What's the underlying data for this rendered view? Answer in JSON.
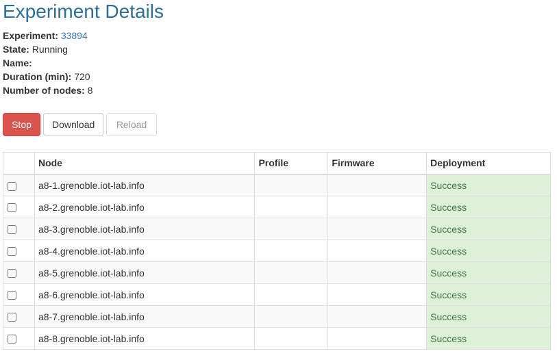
{
  "page": {
    "title": "Experiment Details"
  },
  "info": {
    "experiment_label": "Experiment:",
    "experiment_id": "33894",
    "state_label": "State:",
    "state_value": "Running",
    "name_label": "Name:",
    "name_value": "",
    "duration_label": "Duration (min):",
    "duration_value": "720",
    "nodes_label": "Number of nodes:",
    "nodes_value": "8"
  },
  "toolbar": {
    "stop_label": "Stop",
    "download_label": "Download",
    "reload_label": "Reload"
  },
  "table": {
    "headers": {
      "check": "",
      "node": "Node",
      "profile": "Profile",
      "firmware": "Firmware",
      "deployment": "Deployment"
    },
    "rows": [
      {
        "node": "a8-1.grenoble.iot-lab.info",
        "profile": "",
        "firmware": "",
        "deployment": "Success"
      },
      {
        "node": "a8-2.grenoble.iot-lab.info",
        "profile": "",
        "firmware": "",
        "deployment": "Success"
      },
      {
        "node": "a8-3.grenoble.iot-lab.info",
        "profile": "",
        "firmware": "",
        "deployment": "Success"
      },
      {
        "node": "a8-4.grenoble.iot-lab.info",
        "profile": "",
        "firmware": "",
        "deployment": "Success"
      },
      {
        "node": "a8-5.grenoble.iot-lab.info",
        "profile": "",
        "firmware": "",
        "deployment": "Success"
      },
      {
        "node": "a8-6.grenoble.iot-lab.info",
        "profile": "",
        "firmware": "",
        "deployment": "Success"
      },
      {
        "node": "a8-7.grenoble.iot-lab.info",
        "profile": "",
        "firmware": "",
        "deployment": "Success"
      },
      {
        "node": "a8-8.grenoble.iot-lab.info",
        "profile": "",
        "firmware": "",
        "deployment": "Success"
      }
    ]
  },
  "colors": {
    "title": "#2b6f9a",
    "link": "#337ab7",
    "stop_button": "#d9534f",
    "success_bg": "#dff0d8",
    "success_text": "#3c763d"
  }
}
